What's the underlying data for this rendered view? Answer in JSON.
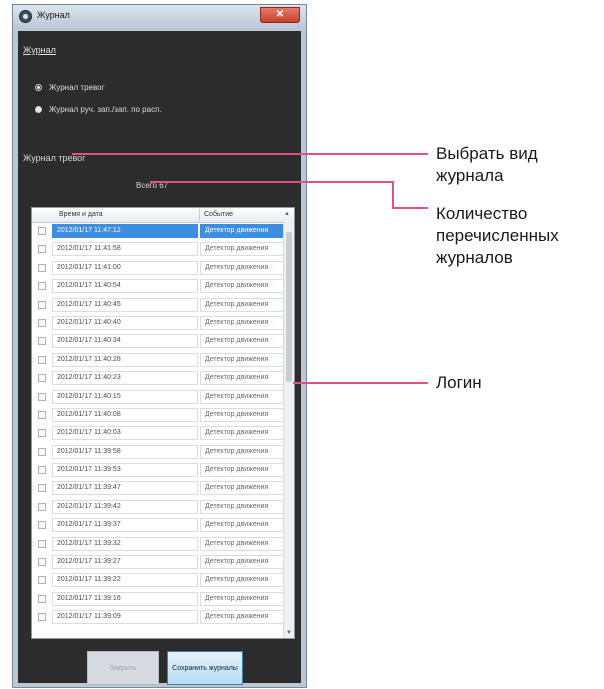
{
  "window": {
    "title": "Журнал",
    "close_glyph": "✕"
  },
  "journal_section": {
    "label": "Журнал",
    "options": [
      {
        "label": "Журнал тревог",
        "selected": false
      },
      {
        "label": "Журнал руч. зап./зап. по расп.",
        "selected": true
      }
    ]
  },
  "journal_select_label": "Журнал тревог",
  "count_label": "Всего 67",
  "table": {
    "columns": [
      "Время и дата",
      "Событие"
    ],
    "rows": [
      {
        "time": "2012/01/17 11:47:12",
        "event": "Детектор движения",
        "selected": true
      },
      {
        "time": "2012/01/17 11:41:58",
        "event": "Детектор движения"
      },
      {
        "time": "2012/01/17 11:41:00",
        "event": "Детектор движения"
      },
      {
        "time": "2012/01/17 11:40:54",
        "event": "Детектор движения"
      },
      {
        "time": "2012/01/17 11:40:45",
        "event": "Детектор движения"
      },
      {
        "time": "2012/01/17 11:40:40",
        "event": "Детектор движения"
      },
      {
        "time": "2012/01/17 11:40:34",
        "event": "Детектор движения"
      },
      {
        "time": "2012/01/17 11:40:28",
        "event": "Детектор движения"
      },
      {
        "time": "2012/01/17 11:40:23",
        "event": "Детектор движения"
      },
      {
        "time": "2012/01/17 11:40:15",
        "event": "Детектор движения"
      },
      {
        "time": "2012/01/17 11:40:08",
        "event": "Детектор движения"
      },
      {
        "time": "2012/01/17 11:40:03",
        "event": "Детектор движения"
      },
      {
        "time": "2012/01/17 11:39:58",
        "event": "Детектор движения"
      },
      {
        "time": "2012/01/17 11:39:53",
        "event": "Детектор движения"
      },
      {
        "time": "2012/01/17 11:39:47",
        "event": "Детектор движения"
      },
      {
        "time": "2012/01/17 11:39:42",
        "event": "Детектор движения"
      },
      {
        "time": "2012/01/17 11:39:37",
        "event": "Детектор движения"
      },
      {
        "time": "2012/01/17 11:39:32",
        "event": "Детектор движения"
      },
      {
        "time": "2012/01/17 11:39:27",
        "event": "Детектор движения"
      },
      {
        "time": "2012/01/17 11:39:22",
        "event": "Детектор движения"
      },
      {
        "time": "2012/01/17 11:39:16",
        "event": "Детектор движения"
      },
      {
        "time": "2012/01/17 11:39:09",
        "event": "Детектор движения"
      }
    ]
  },
  "buttons": {
    "close": "Закрыть",
    "save": "Сохранить журналы"
  },
  "callouts": [
    {
      "text": "Выбрать вид\nжурнала"
    },
    {
      "text": "Количество\nперечисленных\nжурналов"
    },
    {
      "text": "Логин"
    }
  ],
  "colors": {
    "callout_line": "#e04f8e",
    "selected_row": "#3d8ee0",
    "panel": "#2c2c2c"
  }
}
